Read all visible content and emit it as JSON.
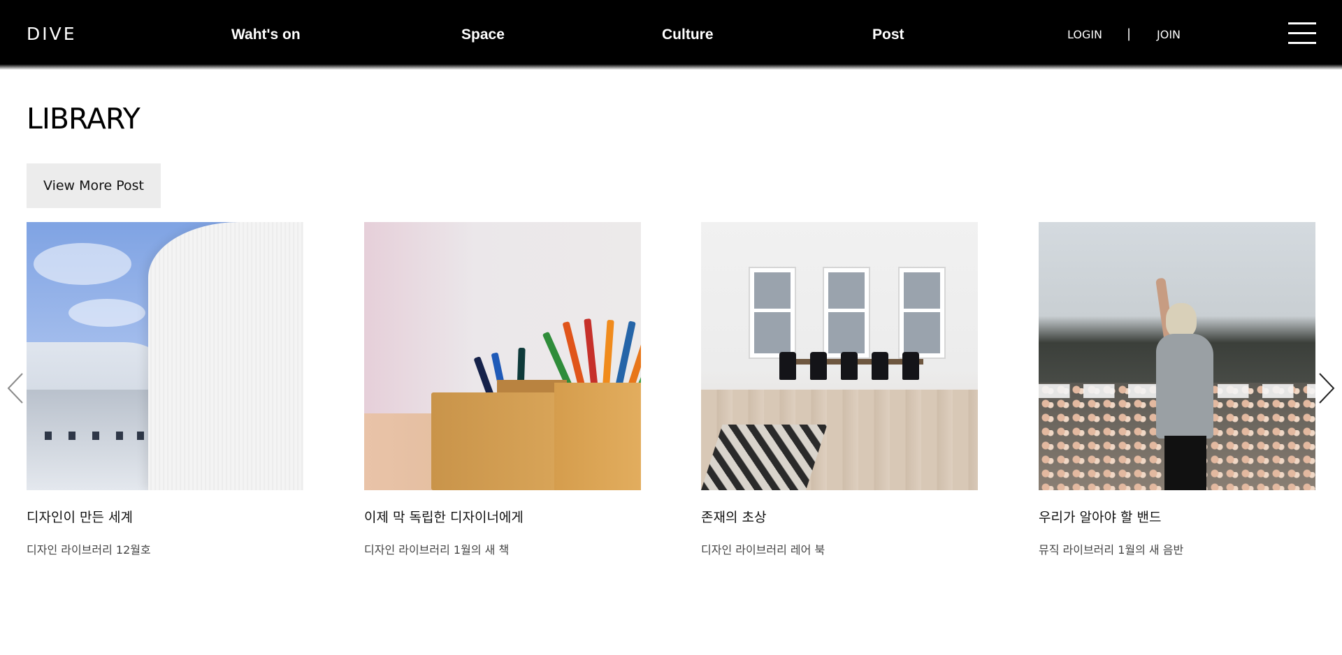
{
  "header": {
    "logo": "DIVE",
    "nav": [
      "Waht's on",
      "Space",
      "Culture",
      "Post"
    ],
    "login": "LOGIN",
    "separator": "|",
    "join": "JOIN",
    "menu_icon": "hamburger-icon"
  },
  "main": {
    "title": "LIBRARY",
    "more_button": "View More Post"
  },
  "cards": [
    {
      "title": "디자인이 만든 세계",
      "subtitle": "디자인 라이브러리 12월호",
      "image": "white curved building against blue sky"
    },
    {
      "title": "이제 막 독립한 디자이너에게",
      "subtitle": "디자인 라이브러리 1월의 새 책",
      "image": "colored pencils in wooden boxes"
    },
    {
      "title": "존재의 초상",
      "subtitle": "디자인 라이브러리 레어 북",
      "image": "bright room with dining table and chairs"
    },
    {
      "title": "우리가 알아야 할 밴드",
      "subtitle": "뮤직 라이브러리 1월의 새 음반",
      "image": "performer facing concert crowd"
    }
  ],
  "carousel": {
    "prev_icon": "chevron-left-icon",
    "next_icon": "chevron-right-icon"
  }
}
